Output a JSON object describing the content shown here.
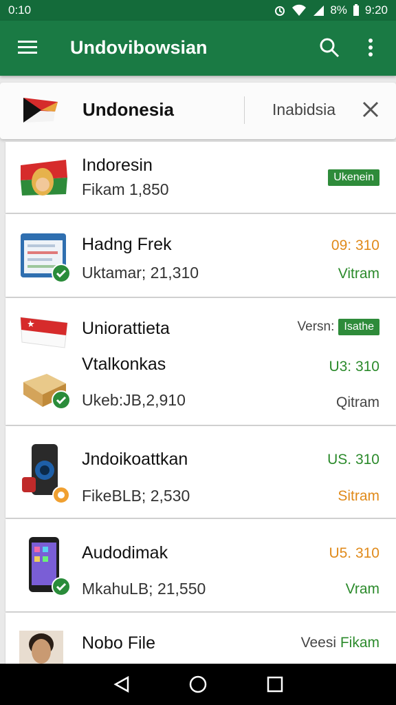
{
  "status": {
    "left": "0:10",
    "battery": "8%",
    "time": "9:20"
  },
  "appbar": {
    "title": "Undovibowsian"
  },
  "searchbar": {
    "query": "Undonesia",
    "lang": "Inabidsia"
  },
  "items": [
    {
      "title": "Indoresin",
      "subtitle": "Fikam 1,850",
      "badge": "Ukenein"
    },
    {
      "title": "Hadng Frek",
      "subtitle": "Uktamar; 21,310",
      "right_top": "09: 310",
      "right_bottom": "Vitram"
    },
    {
      "title": "Uniorattieta",
      "version_label": "Versn:",
      "badge": "Isathe",
      "title2": "Vtalkonkas",
      "right_mid": "U3: 310",
      "subtitle": "Ukeb:JB,2,910",
      "right_bottom": "Qitram"
    },
    {
      "title": "Jndoikoattkan",
      "right_top": "US. 310",
      "subtitle": "FikeBLB; 2,530",
      "right_bottom": "Sitram"
    },
    {
      "title": "Audodimak",
      "right_top": "U5. 310",
      "subtitle": "MkahuLB; 21,550",
      "right_bottom": "Vram"
    },
    {
      "title": "Nobo File",
      "version_label": "Veesi",
      "right_extra": "Fikam"
    }
  ]
}
